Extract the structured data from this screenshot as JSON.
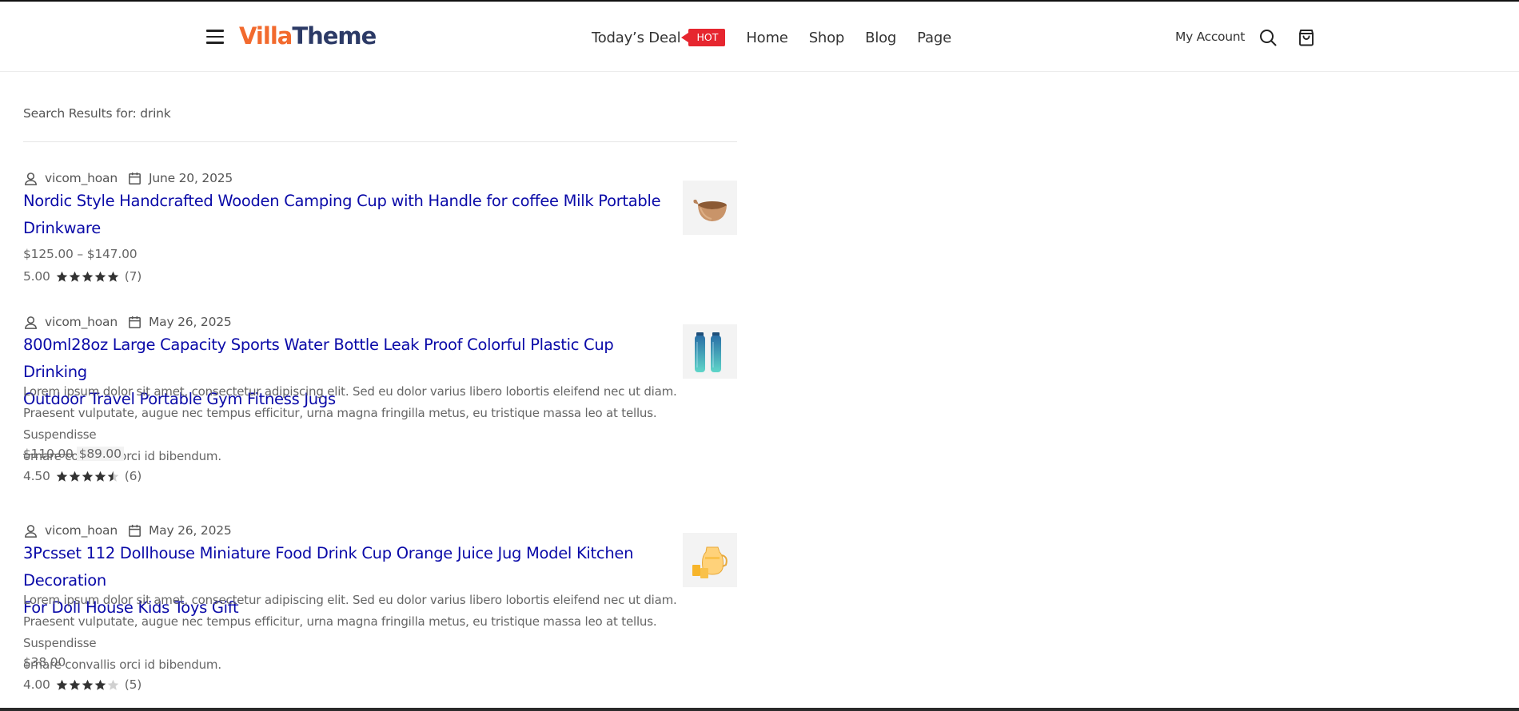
{
  "header": {
    "logo_part1": "Villa",
    "logo_part2": "Theme",
    "nav": {
      "deal_label": "Today’s Deal",
      "hot_badge": "HOT",
      "home": "Home",
      "shop": "Shop",
      "blog": "Blog",
      "page": "Page"
    },
    "account_label": "My Account"
  },
  "colors": {
    "accent": "#f26a2e",
    "brand_dark": "#2c3a66",
    "link": "#0a0aa8",
    "hot": "#e6262f"
  },
  "search": {
    "results_label": "Search Results for: drink"
  },
  "posts": [
    {
      "author": "vicom_hoan",
      "date": "June 20, 2025",
      "title_line1": "Nordic Style Handcrafted Wooden Camping Cup with Handle for coffee Milk Portable",
      "title_line2": "Drinkware",
      "price_range": "$125.00 – $147.00",
      "rating": "5.00",
      "stars": 5,
      "reviews": "(7)",
      "thumb_icon": "wooden-cup-image"
    },
    {
      "author": "vicom_hoan",
      "date": "May 26, 2025",
      "title_line1": "800ml28oz Large Capacity Sports Water Bottle Leak Proof Colorful Plastic Cup Drinking",
      "title_line2": "Outdoor Travel Portable Gym Fitness Jugs",
      "excerpt_line1": "Lorem ipsum dolor sit amet, consectetur adipiscing elit. Sed eu dolor varius libero lobortis eleifend nec ut diam.",
      "excerpt_line2": "Praesent vulputate, augue nec tempus efficitur, urna magna fringilla metus, eu tristique massa leo at tellus. Suspendisse",
      "excerpt_line3": "ornare convallis orci id bibendum.",
      "price_old": "$110.00",
      "price_new": "$89.00",
      "rating": "4.50",
      "stars": 4.5,
      "reviews": "(6)",
      "thumb_icon": "water-bottle-image"
    },
    {
      "author": "vicom_hoan",
      "date": "May 26, 2025",
      "title_line1": "3Pcsset 112 Dollhouse Miniature Food Drink Cup Orange Juice Jug Model Kitchen Decoration",
      "title_line2": "For Doll House Kids Toys Gift",
      "excerpt_line1": "Lorem ipsum dolor sit amet, consectetur adipiscing elit. Sed eu dolor varius libero lobortis eleifend nec ut diam.",
      "excerpt_line2": "Praesent vulputate, augue nec tempus efficitur, urna magna fringilla metus, eu tristique massa leo at tellus. Suspendisse",
      "excerpt_line3": "ornare convallis orci id bibendum.",
      "price": "$38.00",
      "rating": "4.00",
      "stars": 4,
      "reviews": "(5)",
      "thumb_icon": "juice-jug-image"
    }
  ]
}
